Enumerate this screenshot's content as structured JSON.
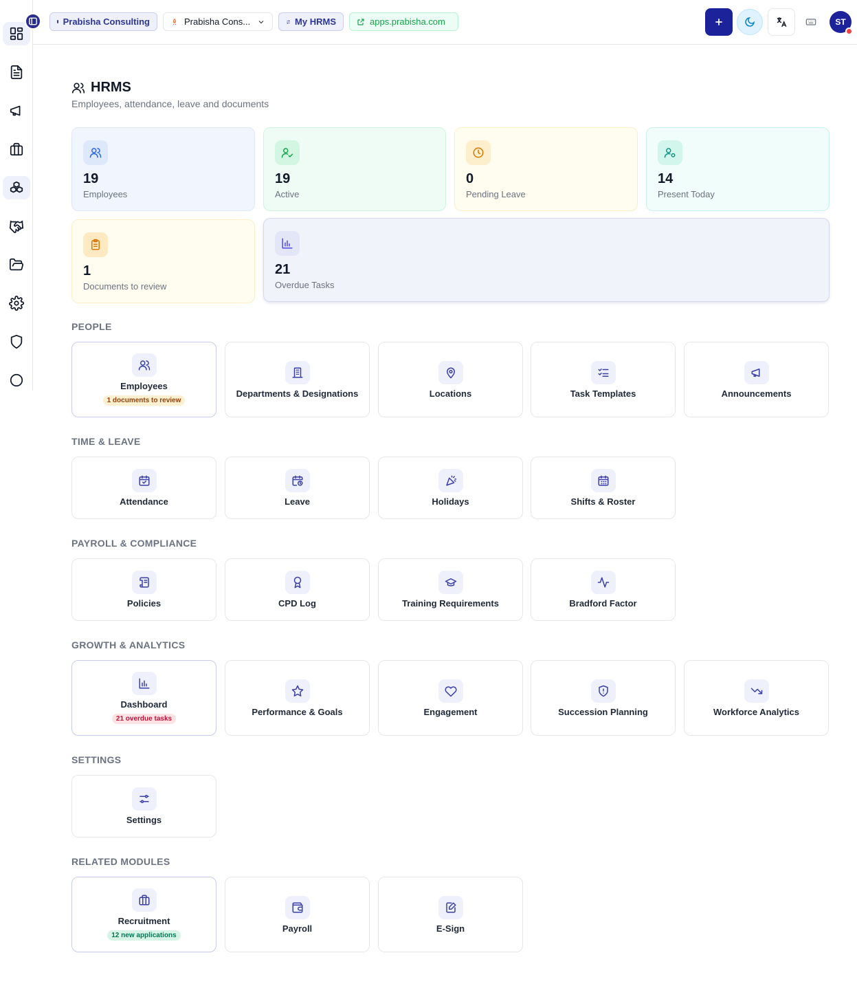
{
  "topbar": {
    "org_chip": "Prabisha Consulting",
    "org_select": "Prabisha Cons...",
    "module_chip": "My HRMS",
    "url_chip": "apps.prabisha.com",
    "avatar_initials": "ST"
  },
  "header": {
    "title": "HRMS",
    "subtitle": "Employees, attendance, leave and documents"
  },
  "stats": [
    {
      "value": "19",
      "label": "Employees",
      "bg": "#f1f5fd",
      "border": "#dde6f6",
      "icon_bg": "#dde8fb",
      "icon_color": "#2563eb",
      "icon": "users-icon"
    },
    {
      "value": "19",
      "label": "Active",
      "bg": "#effcf5",
      "border": "#cdf3de",
      "icon_bg": "#d3f6e2",
      "icon_color": "#16a34a",
      "icon": "user-check-icon"
    },
    {
      "value": "0",
      "label": "Pending Leave",
      "bg": "#fffcf0",
      "border": "#fcefc8",
      "icon_bg": "#fdefcc",
      "icon_color": "#d97706",
      "icon": "clock-icon"
    },
    {
      "value": "14",
      "label": "Present Today",
      "bg": "#f0fdfa",
      "border": "#cbf2e8",
      "icon_bg": "#d2f5ec",
      "icon_color": "#0d9488",
      "icon": "user-cog-icon"
    },
    {
      "value": "1",
      "label": "Documents to review",
      "bg": "#fffcf0",
      "border": "#fcefc8",
      "icon_bg": "#fde9c2",
      "icon_color": "#d97706",
      "icon": "clipboard-icon"
    },
    {
      "value": "21",
      "label": "Overdue Tasks",
      "bg": "#f1f3fb",
      "border": "#d5daf0",
      "icon_bg": "#e2e6f7",
      "icon_color": "#4f46e5",
      "icon": "bar-chart-icon"
    }
  ],
  "sections": [
    {
      "title": "PEOPLE",
      "tiles": [
        {
          "label": "Employees",
          "badge": "1 documents to review",
          "badge_bg": "#fdf0d0",
          "badge_color": "#92400e",
          "icon": "users-icon"
        },
        {
          "label": "Departments & Designations",
          "icon": "building-icon"
        },
        {
          "label": "Locations",
          "icon": "map-pin-icon"
        },
        {
          "label": "Task Templates",
          "icon": "list-checks-icon"
        },
        {
          "label": "Announcements",
          "icon": "megaphone-icon"
        }
      ]
    },
    {
      "title": "TIME & LEAVE",
      "tiles": [
        {
          "label": "Attendance",
          "icon": "calendar-check-icon"
        },
        {
          "label": "Leave",
          "icon": "calendar-clock-icon"
        },
        {
          "label": "Holidays",
          "icon": "party-popper-icon"
        },
        {
          "label": "Shifts & Roster",
          "icon": "calendar-days-icon"
        }
      ]
    },
    {
      "title": "PAYROLL & COMPLIANCE",
      "tiles": [
        {
          "label": "Policies",
          "icon": "scroll-icon"
        },
        {
          "label": "CPD Log",
          "icon": "award-icon"
        },
        {
          "label": "Training Requirements",
          "icon": "graduation-cap-icon"
        },
        {
          "label": "Bradford Factor",
          "icon": "activity-icon"
        }
      ]
    },
    {
      "title": "GROWTH & ANALYTICS",
      "tiles": [
        {
          "label": "Dashboard",
          "badge": "21 overdue tasks",
          "badge_bg": "#fde2e4",
          "badge_color": "#be123c",
          "icon": "bar-chart-icon"
        },
        {
          "label": "Performance & Goals",
          "icon": "star-icon"
        },
        {
          "label": "Engagement",
          "icon": "heart-icon"
        },
        {
          "label": "Succession Planning",
          "icon": "shield-alert-icon"
        },
        {
          "label": "Workforce Analytics",
          "icon": "trending-down-icon"
        }
      ]
    },
    {
      "title": "SETTINGS",
      "tiles": [
        {
          "label": "Settings",
          "icon": "sliders-icon"
        }
      ]
    },
    {
      "title": "RELATED MODULES",
      "tiles": [
        {
          "label": "Recruitment",
          "badge": "12 new applications",
          "badge_bg": "#d7f5e6",
          "badge_color": "#047857",
          "icon": "briefcase-icon"
        },
        {
          "label": "Payroll",
          "icon": "wallet-icon"
        },
        {
          "label": "E-Sign",
          "icon": "file-signature-icon"
        }
      ]
    }
  ],
  "rail": [
    {
      "icon": "dashboard-grid-icon",
      "active": true
    },
    {
      "icon": "file-text-icon"
    },
    {
      "icon": "megaphone-icon"
    },
    {
      "icon": "briefcase-icon"
    },
    {
      "icon": "boxes-icon",
      "active": true
    },
    {
      "icon": "handshake-icon"
    },
    {
      "icon": "folder-open-icon"
    },
    {
      "icon": "settings-gear-icon"
    },
    {
      "icon": "shield-icon"
    },
    {
      "icon": "circle-icon"
    }
  ],
  "colors": {
    "accent": "#1c239a",
    "tile_icon": "#3a3fa8",
    "rail_icon": "#111827"
  }
}
